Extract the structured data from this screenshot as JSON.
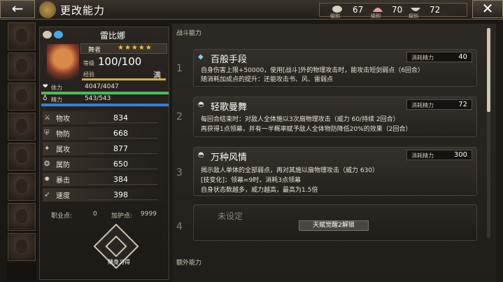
{
  "header": {
    "back_icon": "←",
    "title": "更改能力",
    "close_icon": "✕",
    "currencies": [
      {
        "icon": "crest-icon",
        "label": "级别",
        "value": "67"
      },
      {
        "icon": "shell-icon",
        "label": "级别",
        "value": "70"
      },
      {
        "icon": "bowl-icon",
        "label": "级别",
        "value": "72"
      }
    ]
  },
  "character": {
    "name": "雷比娜",
    "class": "舞者",
    "stars": "★★★★★",
    "level_label": "等级",
    "level": "100/100",
    "exp_label": "经验",
    "exp_status": "满",
    "hp_label": "体力",
    "hp_value": "4047/4047",
    "mp_label": "精力",
    "mp_value": "543/543",
    "stats": [
      {
        "icon": "sword-icon",
        "glyph": "⚔",
        "name": "物攻",
        "value": "834"
      },
      {
        "icon": "shield-icon",
        "glyph": "⛨",
        "name": "物防",
        "value": "668"
      },
      {
        "icon": "staff-icon",
        "glyph": "✦",
        "name": "属攻",
        "value": "877"
      },
      {
        "icon": "orb-icon",
        "glyph": "❂",
        "name": "属防",
        "value": "650"
      },
      {
        "icon": "crit-icon",
        "glyph": "✸",
        "name": "暴击",
        "value": "384"
      },
      {
        "icon": "boot-icon",
        "glyph": "➶",
        "name": "速度",
        "value": "398"
      }
    ],
    "job_points_label": "职业点:",
    "job_points": "0",
    "guard_points_label": "加护点:",
    "guard_points": "9999",
    "rebirth_label": "随身习得"
  },
  "abilities": {
    "battle_section": "战斗能力",
    "extra_section": "额外能力",
    "cost_label": "消耗精力",
    "slots": [
      {
        "number": "1",
        "name": "百般手段",
        "cost": "40",
        "desc": [
          "自身伤害上限+50000，使用[战斗]外的物理攻击时，能攻击短剑弱点（6回合）",
          "随消耗加成点的提升：还能攻击书、风、雷弱点"
        ]
      },
      {
        "number": "2",
        "name": "轻歌曼舞",
        "cost": "72",
        "desc": [
          "每回合结束时：对敌人全体施以3次扇物理攻击（威力 60/持续 2回合）",
          "再获得1点领幕，并有一半概率赋予敌人全体物防降低20%的效果（2回合）"
        ]
      },
      {
        "number": "3",
        "name": "万种风情",
        "cost": "300",
        "desc": [
          "揭示敌人单体的全部弱点，再对其施以扇物理攻击（威力 630）",
          "[技变化]：领幕=9时，消耗3点领幕",
          "自身状态数越多，威力越高，最高为1.5倍"
        ]
      },
      {
        "number": "4",
        "empty_label": "未设定",
        "unlock": "天赋觉醒2解锁"
      }
    ]
  }
}
